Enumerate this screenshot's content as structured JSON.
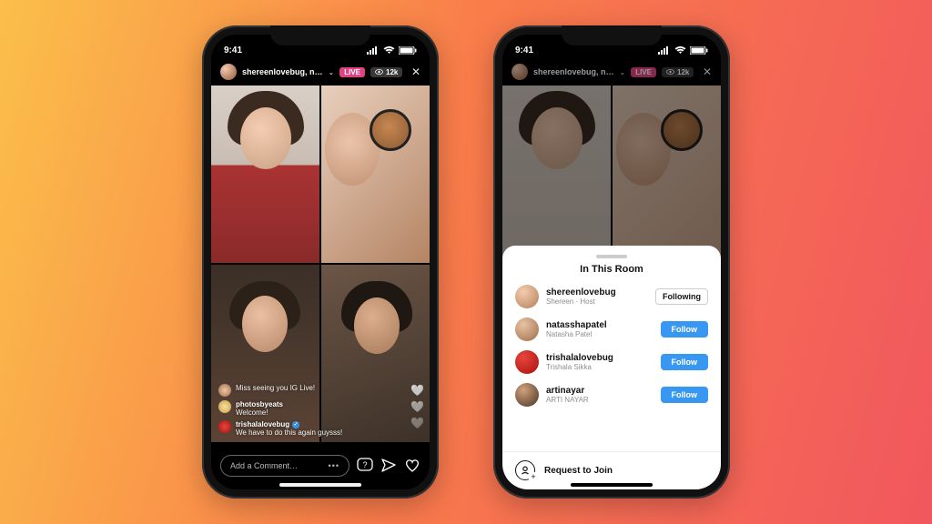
{
  "statusbar": {
    "time": "9:41"
  },
  "live_header": {
    "username": "shereenlovebug, n…",
    "live_label": "LIVE",
    "viewer_count": "12k"
  },
  "comments": [
    {
      "user": "",
      "text": "Miss seeing you IG Live!"
    },
    {
      "user": "photosbyeats",
      "text": "Welcome!"
    },
    {
      "user": "trishalalovebug",
      "text": "We have to do this again guysss!",
      "verified": true
    }
  ],
  "comment_input": {
    "placeholder": "Add a Comment…",
    "more": "•••"
  },
  "sheet": {
    "title": "In This Room",
    "participants": [
      {
        "username": "shereenlovebug",
        "subtitle": "Shereen · Host",
        "action": "Following",
        "action_type": "following"
      },
      {
        "username": "natasshapatel",
        "subtitle": "Natasha Patel",
        "action": "Follow",
        "action_type": "follow"
      },
      {
        "username": "trishalalovebug",
        "subtitle": "Trishala Sikka",
        "action": "Follow",
        "action_type": "follow"
      },
      {
        "username": "artinayar",
        "subtitle": "ARTI NAYAR",
        "action": "Follow",
        "action_type": "follow"
      }
    ],
    "request_label": "Request to Join"
  }
}
